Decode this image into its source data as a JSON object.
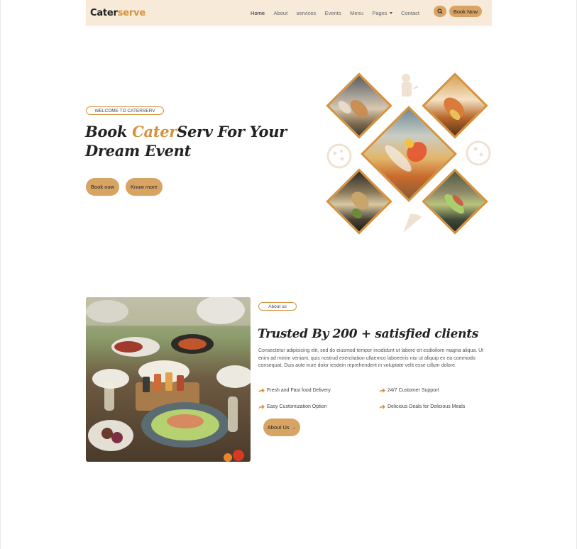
{
  "navbar": {
    "brand_main": "Cater",
    "brand_accent": "serve",
    "links": [
      {
        "label": "Home",
        "active": true
      },
      {
        "label": "About"
      },
      {
        "label": "services"
      },
      {
        "label": "Events"
      },
      {
        "label": "Menu"
      },
      {
        "label": "Pages",
        "dropdown": true
      },
      {
        "label": "Contact"
      }
    ],
    "search_icon": "search-icon",
    "book_label": "Book Now"
  },
  "hero": {
    "badge": "WELCOME TO CATERSERV",
    "title_part1": "Book ",
    "title_accent": "Cater",
    "title_part2": "Serv For Your Dream Event",
    "book_button": "Book now",
    "know_button": "Know more"
  },
  "about": {
    "badge": "About us",
    "title": "Trusted By 200 + satisfied clients",
    "text": "Consectetur adipisicing elit, sed do eiusmod tempor incididunt ut labore eit esdioilore magna aliqua. Ut enim ad minim veniam, quis nostrud exercitation ullaemco laboeeiris nisi ut aliquip ex ea commodo consequat. Duis aute irure dolor iesdein reprehenderit in voluptate velit esse cillum dolore.",
    "features": [
      "Fresh and Fast food Delivery",
      "24/7 Customer Support",
      "Easy Customization Option",
      "Delicious Deals for Delicious Meals"
    ],
    "button": "About Us →"
  },
  "colors": {
    "accent": "#d4923f",
    "button": "#d8a463",
    "navbar_bg": "#f7ead8"
  }
}
